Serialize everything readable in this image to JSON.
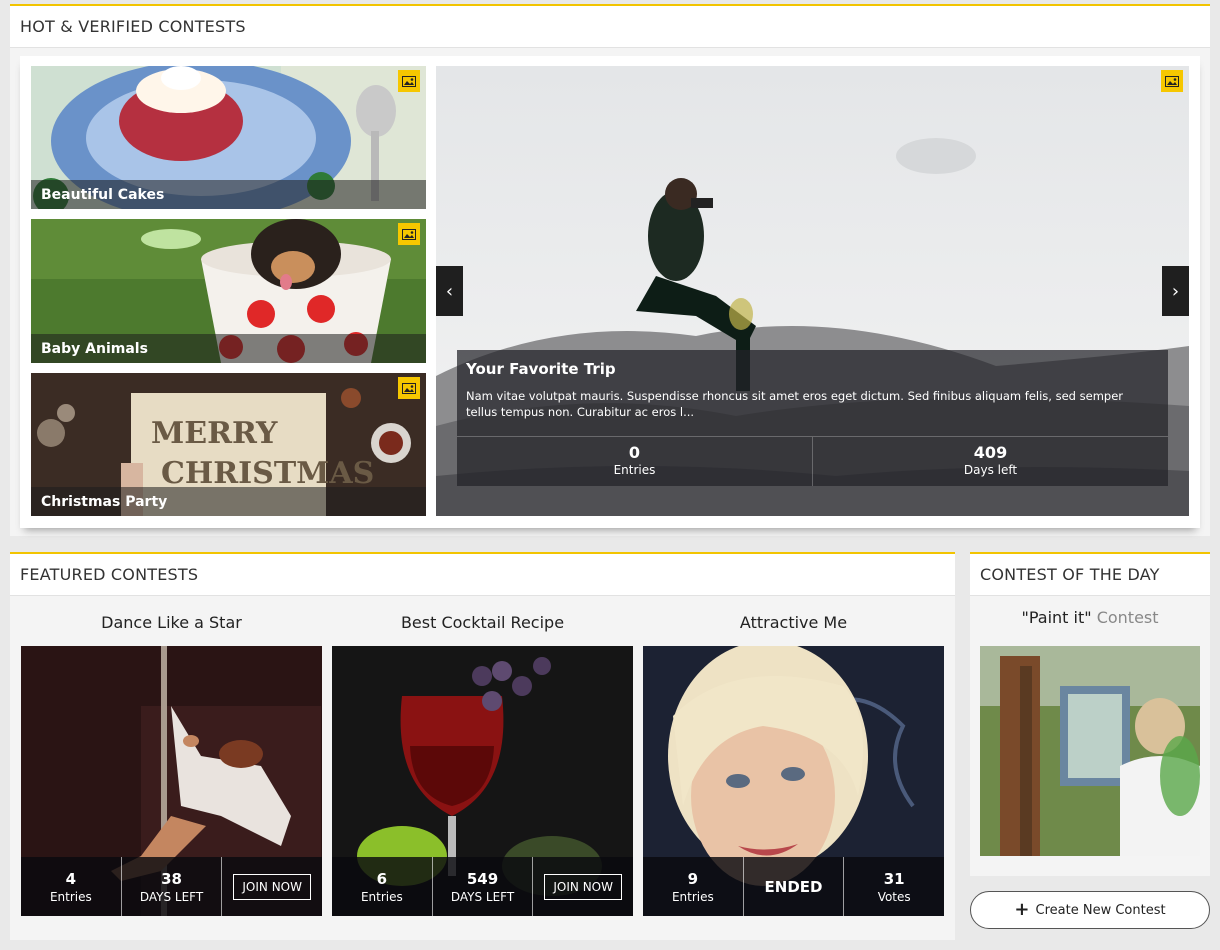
{
  "hot": {
    "title": "HOT & VERIFIED CONTESTS",
    "tiles": [
      {
        "label": "Beautiful Cakes",
        "icon": "image-icon"
      },
      {
        "label": "Baby Animals",
        "icon": "image-icon"
      },
      {
        "label": "Christmas Party",
        "icon": "image-icon"
      }
    ],
    "featured": {
      "title": "Your Favorite Trip",
      "description": "Nam vitae volutpat mauris. Suspendisse rhoncus sit amet eros eget dictum. Sed finibus aliquam felis, sed semper tellus tempus non. Curabitur ac eros l...",
      "entries_value": "0",
      "entries_label": "Entries",
      "days_value": "409",
      "days_label": "Days left",
      "prev_icon": "chevron-left-icon",
      "next_icon": "chevron-right-icon"
    }
  },
  "featured": {
    "title": "FEATURED CONTESTS",
    "cards": [
      {
        "title": "Dance Like a Star",
        "entries": "4",
        "entries_label": "Entries",
        "days": "38",
        "days_label": "DAYS LEFT",
        "action": "JOIN NOW"
      },
      {
        "title": "Best Cocktail Recipe",
        "entries": "6",
        "entries_label": "Entries",
        "days": "549",
        "days_label": "DAYS LEFT",
        "action": "JOIN NOW"
      },
      {
        "title": "Attractive Me",
        "entries": "9",
        "entries_label": "Entries",
        "status": "ENDED",
        "votes": "31",
        "votes_label": "Votes"
      }
    ]
  },
  "cotd": {
    "title": "CONTEST OF THE DAY",
    "contest_name": "\"Paint it\"",
    "contest_suffix": "Contest"
  },
  "create_button": {
    "label": "Create New Contest",
    "icon": "plus-icon"
  },
  "colors": {
    "accent": "#f2c400",
    "badge": "#f6c700"
  }
}
